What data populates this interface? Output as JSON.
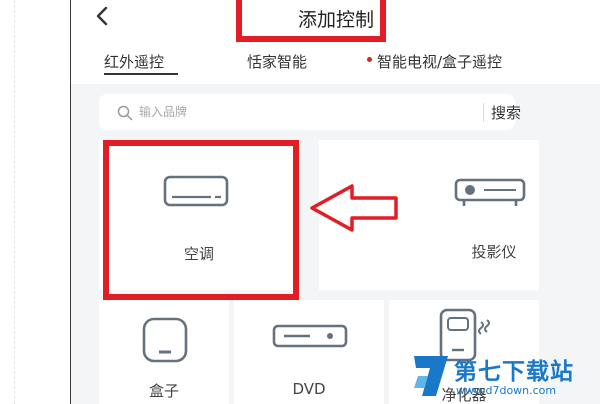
{
  "header": {
    "title": "添加控制",
    "back_icon": "chevron-left-icon"
  },
  "tabs": [
    {
      "label": "红外遥控",
      "active": true
    },
    {
      "label": "恬家智能",
      "active": false
    },
    {
      "label": "智能电视/盒子遥控",
      "active": false,
      "dot_color": "#d9231d"
    }
  ],
  "search": {
    "placeholder": "输入品牌",
    "button_label": "搜索",
    "icon": "search-icon"
  },
  "devices": [
    {
      "label": "空调",
      "icon": "air-conditioner-icon"
    },
    {
      "label": "投影仪",
      "icon": "projector-icon"
    },
    {
      "label": "盒子",
      "icon": "tv-box-icon"
    },
    {
      "label": "DVD",
      "icon": "dvd-player-icon"
    },
    {
      "label": "净化器",
      "icon": "air-purifier-icon"
    }
  ],
  "annotations": {
    "highlight_color": "#e21d25",
    "arrow_icon": "left-arrow-icon"
  },
  "watermark": {
    "name": "第七下载站",
    "url": "www.d7down.com",
    "color": "#1a78c8"
  }
}
